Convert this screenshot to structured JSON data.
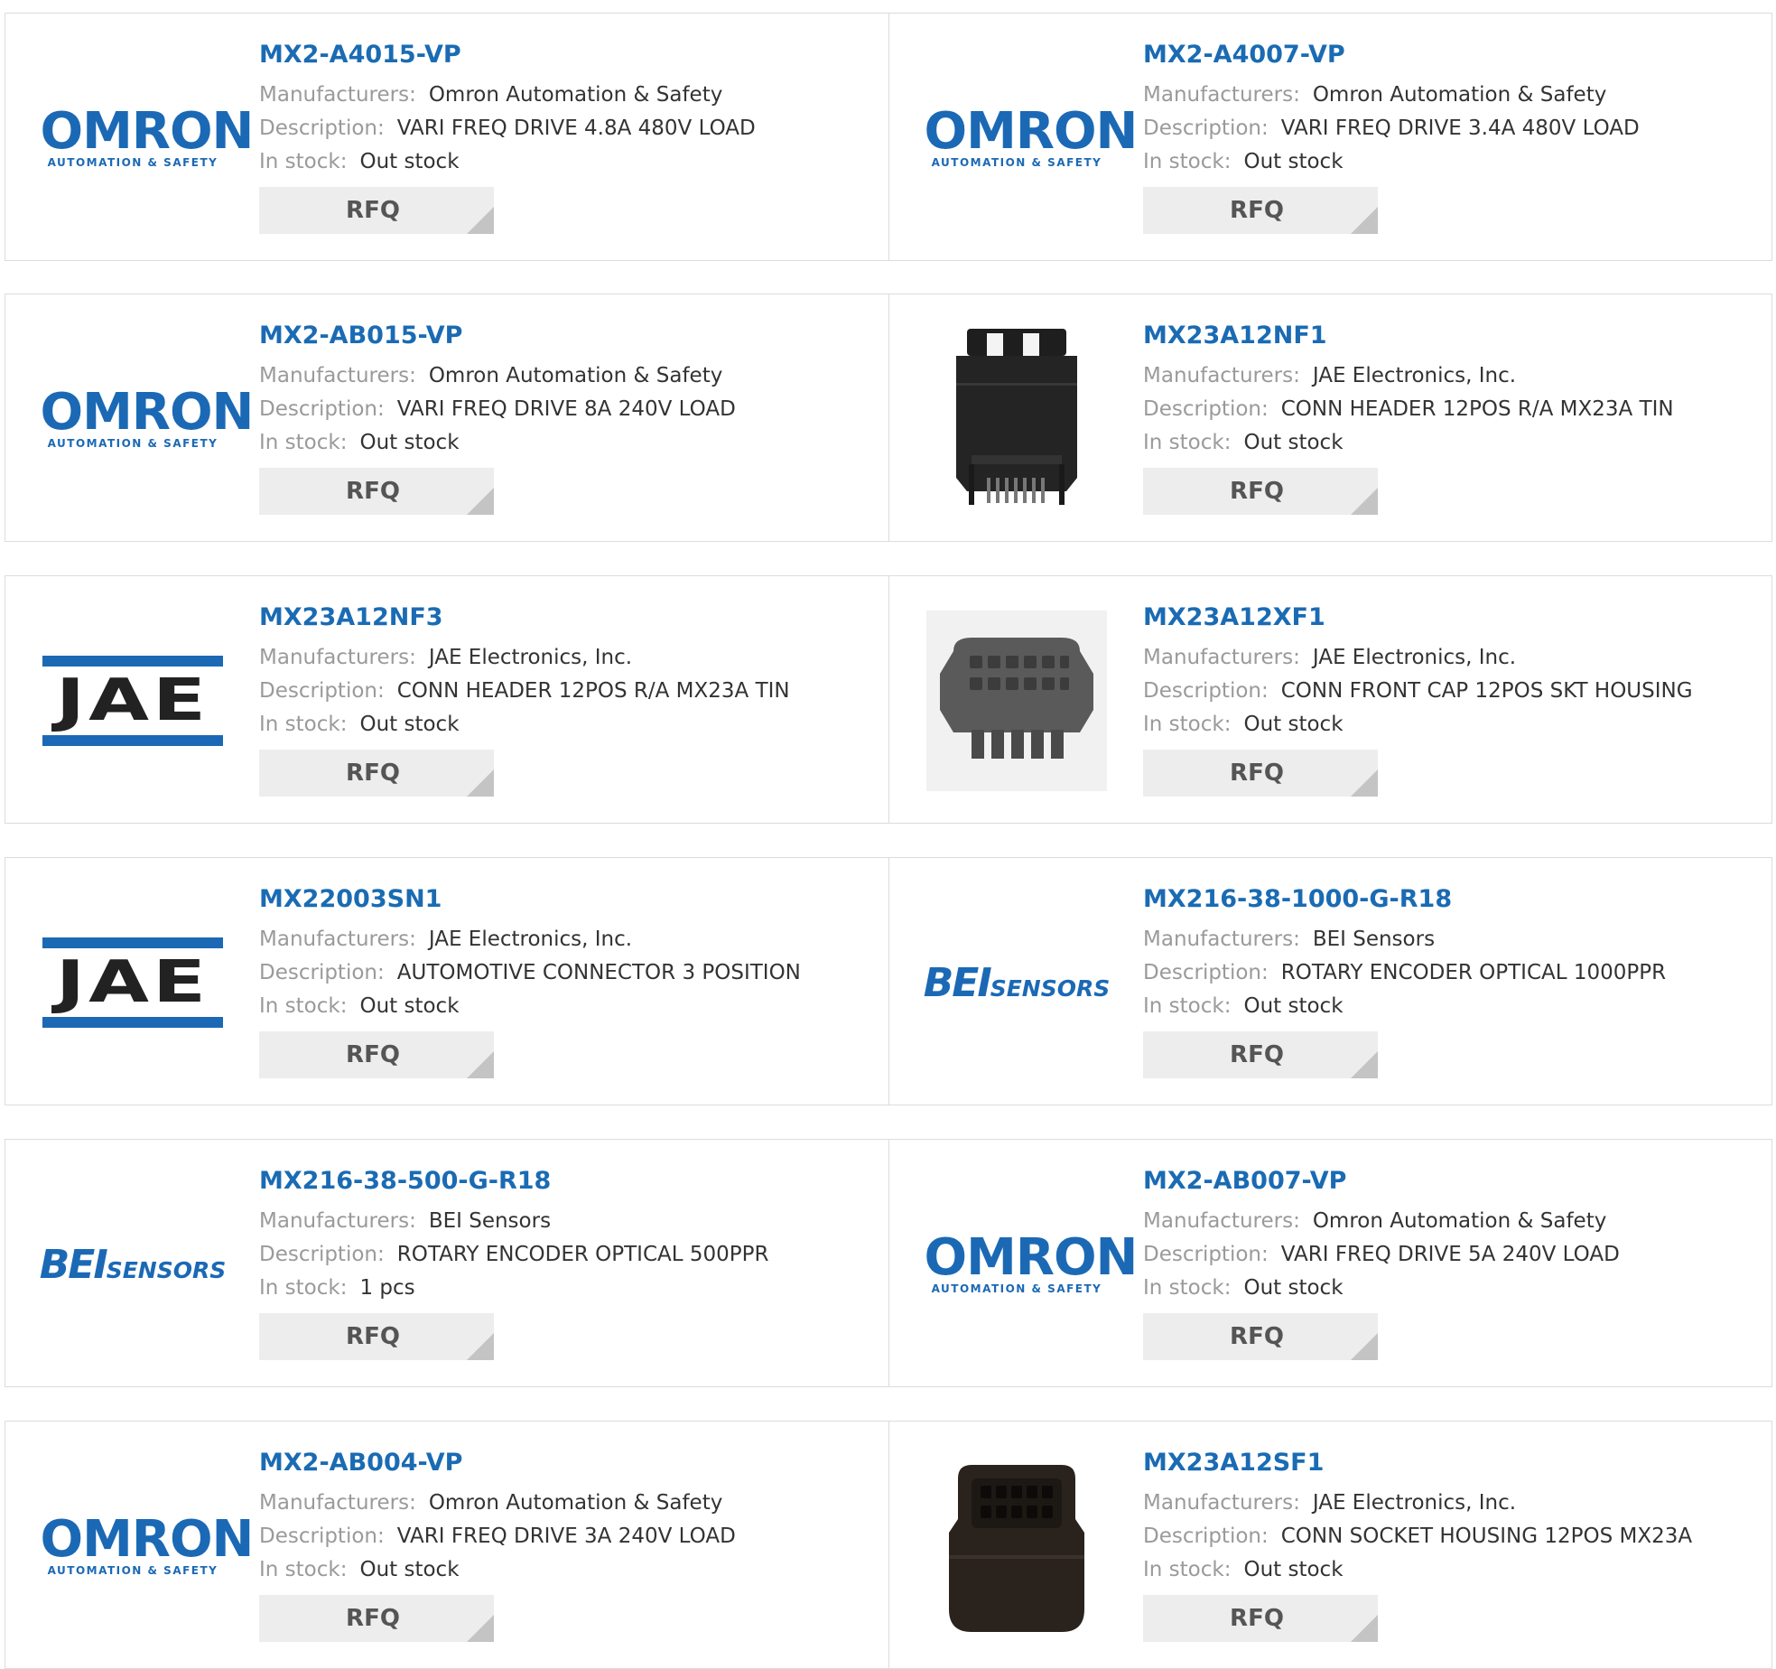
{
  "labels": {
    "manufacturers": "Manufacturers:",
    "description": "Description:",
    "in_stock": "In stock:",
    "rfq": "RFQ"
  },
  "logos": {
    "omron": {
      "word": "OMRON",
      "sub": "AUTOMATION & SAFETY",
      "color": "#1b69b5"
    },
    "jae": {
      "word": "JAE",
      "color": "#1b69b5"
    },
    "bei": {
      "big": "BEI",
      "small": "SENSORS",
      "color": "#1b69b5"
    }
  },
  "colors": {
    "part_link": "#1a6bb3",
    "rfq_bg": "#ededed",
    "border": "#dcdcdc"
  },
  "products": [
    {
      "part": "MX2-A4015-VP",
      "manufacturer": "Omron Automation & Safety",
      "description": "VARI FREQ DRIVE 4.8A 480V LOAD",
      "stock": "Out stock",
      "image": "omron-logo"
    },
    {
      "part": "MX2-A4007-VP",
      "manufacturer": "Omron Automation & Safety",
      "description": "VARI FREQ DRIVE 3.4A 480V LOAD",
      "stock": "Out stock",
      "image": "omron-logo"
    },
    {
      "part": "MX2-AB015-VP",
      "manufacturer": "Omron Automation & Safety",
      "description": "VARI FREQ DRIVE 8A 240V LOAD",
      "stock": "Out stock",
      "image": "omron-logo"
    },
    {
      "part": "MX23A12NF1",
      "manufacturer": "JAE Electronics, Inc.",
      "description": "CONN HEADER 12POS R/A MX23A TIN",
      "stock": "Out stock",
      "image": "connector-header-photo"
    },
    {
      "part": "MX23A12NF3",
      "manufacturer": "JAE Electronics, Inc.",
      "description": "CONN HEADER 12POS R/A MX23A TIN",
      "stock": "Out stock",
      "image": "jae-logo"
    },
    {
      "part": "MX23A12XF1",
      "manufacturer": "JAE Electronics, Inc.",
      "description": "CONN FRONT CAP 12POS SKT HOUSING",
      "stock": "Out stock",
      "image": "connector-cap-photo"
    },
    {
      "part": "MX22003SN1",
      "manufacturer": "JAE Electronics, Inc.",
      "description": "AUTOMOTIVE CONNECTOR 3 POSITION",
      "stock": "Out stock",
      "image": "jae-logo"
    },
    {
      "part": "MX216-38-1000-G-R18",
      "manufacturer": "BEI Sensors",
      "description": "ROTARY ENCODER OPTICAL 1000PPR",
      "stock": "Out stock",
      "image": "bei-logo"
    },
    {
      "part": "MX216-38-500-G-R18",
      "manufacturer": "BEI Sensors",
      "description": "ROTARY ENCODER OPTICAL 500PPR",
      "stock": "1 pcs",
      "image": "bei-logo"
    },
    {
      "part": "MX2-AB007-VP",
      "manufacturer": "Omron Automation & Safety",
      "description": "VARI FREQ DRIVE 5A 240V LOAD",
      "stock": "Out stock",
      "image": "omron-logo"
    },
    {
      "part": "MX2-AB004-VP",
      "manufacturer": "Omron Automation & Safety",
      "description": "VARI FREQ DRIVE 3A 240V LOAD",
      "stock": "Out stock",
      "image": "omron-logo"
    },
    {
      "part": "MX23A12SF1",
      "manufacturer": "JAE Electronics, Inc.",
      "description": "CONN SOCKET HOUSING 12POS MX23A",
      "stock": "Out stock",
      "image": "connector-socket-photo"
    }
  ]
}
